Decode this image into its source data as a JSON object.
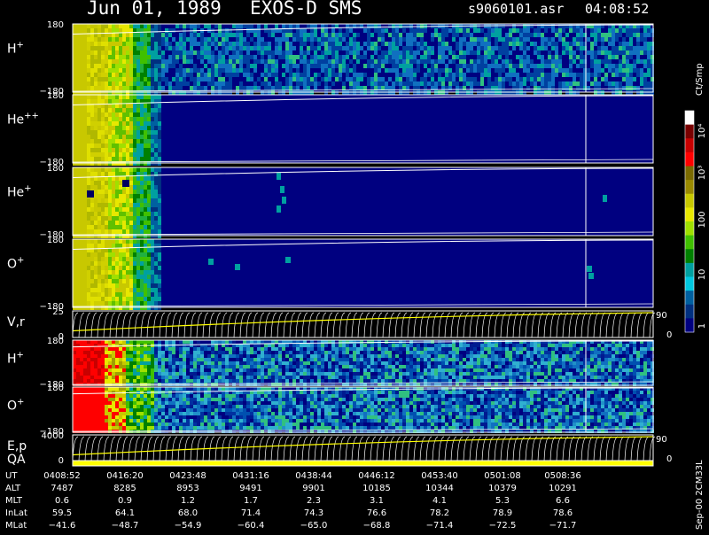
{
  "header": {
    "date": "Jun 01, 1989",
    "instrument": "EXOS-D SMS",
    "file": "s9060101.asr",
    "time": "04:08:52"
  },
  "colorbar": {
    "title": "Ct/Smp",
    "tick_labels": [
      "10⁴",
      "10³",
      "100",
      "10",
      "1"
    ],
    "colors": [
      "#ffffff",
      "#7a0000",
      "#c80000",
      "#ff0000",
      "#7a6a00",
      "#9a8a00",
      "#c8c800",
      "#e8e800",
      "#a0e000",
      "#40c000",
      "#008000",
      "#00a0a0",
      "#00c8e0",
      "#0060a0",
      "#003080",
      "#000080"
    ]
  },
  "panels": [
    {
      "id": "h-plus-1",
      "base": "H",
      "sup": "+",
      "ymax": "180",
      "ymin": "−180"
    },
    {
      "id": "he-pp",
      "base": "He",
      "sup": "++",
      "ymax": "180",
      "ymin": "−180"
    },
    {
      "id": "he-plus",
      "base": "He",
      "sup": "+",
      "ymax": "180",
      "ymin": "−180"
    },
    {
      "id": "o-plus-1",
      "base": "O",
      "sup": "+",
      "ymax": "180",
      "ymin": "−180"
    },
    {
      "id": "vr",
      "base": "V,r",
      "sup": "",
      "ymax": "25",
      "ymin": "0",
      "rmax": "90",
      "rmin": "0"
    },
    {
      "id": "h-plus-2",
      "base": "H",
      "sup": "+",
      "ymax": "180",
      "ymin": "−180"
    },
    {
      "id": "o-plus-2",
      "base": "O",
      "sup": "+",
      "ymax": "180",
      "ymin": "−180"
    },
    {
      "id": "ep",
      "base": "E,p",
      "sup": "",
      "ymax": "4000",
      "ymin": "0",
      "rmax": "90",
      "rmin": "0"
    },
    {
      "id": "qa",
      "base": "QA",
      "sup": ""
    }
  ],
  "footer": {
    "row_labels": [
      "UT",
      "ALT",
      "MLT",
      "InLat",
      "MLat"
    ],
    "columns": [
      {
        "UT": "0408:52",
        "ALT": "7487",
        "MLT": "0.6",
        "InLat": "59.5",
        "MLat": "−41.6"
      },
      {
        "UT": "0416:20",
        "ALT": "8285",
        "MLT": "0.9",
        "InLat": "64.1",
        "MLat": "−48.7"
      },
      {
        "UT": "0423:48",
        "ALT": "8953",
        "MLT": "1.2",
        "InLat": "68.0",
        "MLat": "−54.9"
      },
      {
        "UT": "0431:16",
        "ALT": "9491",
        "MLT": "1.7",
        "InLat": "71.4",
        "MLat": "−60.4"
      },
      {
        "UT": "0438:44",
        "ALT": "9901",
        "MLT": "2.3",
        "InLat": "74.3",
        "MLat": "−65.0"
      },
      {
        "UT": "0446:12",
        "ALT": "10185",
        "MLT": "3.1",
        "InLat": "76.6",
        "MLat": "−68.8"
      },
      {
        "UT": "0453:40",
        "ALT": "10344",
        "MLT": "4.1",
        "InLat": "78.2",
        "MLat": "−71.4"
      },
      {
        "UT": "0501:08",
        "ALT": "10379",
        "MLT": "5.3",
        "InLat": "78.9",
        "MLat": "−72.5"
      },
      {
        "UT": "0508:36",
        "ALT": "10291",
        "MLT": "6.6",
        "InLat": "78.6",
        "MLat": "−71.7"
      }
    ],
    "side_text": "Sep-00 2CM33L"
  },
  "chart_data": {
    "type": "heatmap",
    "title": "Jun 01, 1989   EXOS-D SMS",
    "x_ticks_ut": [
      "0408:52",
      "0416:20",
      "0423:48",
      "0431:16",
      "0438:44",
      "0446:12",
      "0453:40",
      "0501:08",
      "0508:36"
    ],
    "colorbar_range": [
      1,
      10000
    ],
    "colorbar_scale": "log",
    "colorbar_unit": "Ct/Smp",
    "panels": [
      {
        "name": "H+",
        "ylim": [
          -180,
          180
        ]
      },
      {
        "name": "He++",
        "ylim": [
          -180,
          180
        ]
      },
      {
        "name": "He+",
        "ylim": [
          -180,
          180
        ]
      },
      {
        "name": "O+",
        "ylim": [
          -180,
          180
        ]
      },
      {
        "name": "V,r",
        "ylim": [
          0,
          25
        ],
        "right_ylim": [
          0,
          90
        ]
      },
      {
        "name": "H+",
        "ylim": [
          -180,
          180
        ]
      },
      {
        "name": "O+",
        "ylim": [
          -180,
          180
        ]
      },
      {
        "name": "E,p",
        "ylim": [
          0,
          4000
        ],
        "right_ylim": [
          0,
          90
        ]
      },
      {
        "name": "QA"
      }
    ]
  }
}
